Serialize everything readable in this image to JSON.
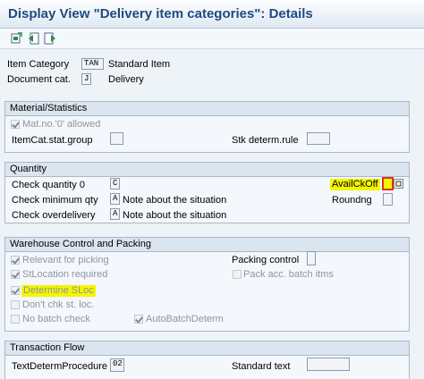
{
  "window": {
    "title": "Display View \"Delivery item categories\": Details"
  },
  "header": {
    "item_category_label": "Item Category",
    "item_category_value": "TAN",
    "item_category_desc": "Standard Item",
    "document_cat_label": "Document cat.",
    "document_cat_value": "J",
    "document_cat_desc": "Delivery"
  },
  "material_statistics": {
    "title": "Material/Statistics",
    "mat_no_label": "Mat.no.'0' allowed",
    "mat_no_checked": true,
    "itemcat_stat_label": "ItemCat.stat.group",
    "itemcat_stat_value": "",
    "stk_determ_label": "Stk determ.rule",
    "stk_determ_value": ""
  },
  "quantity": {
    "title": "Quantity",
    "check_qty_label": "Check quantity 0",
    "check_qty_value": "C",
    "check_min_label": "Check minimum qty",
    "check_min_value": "A",
    "check_min_desc": "Note about the situation",
    "check_over_label": "Check overdelivery",
    "check_over_value": "A",
    "check_over_desc": "Note about the situation",
    "availckoff_label": "AvailCkOff",
    "availckoff_value": "",
    "roundng_label": "Roundng",
    "roundng_value": ""
  },
  "warehouse": {
    "title": "Warehouse Control and Packing",
    "relevant_picking_label": "Relevant for picking",
    "relevant_picking_checked": true,
    "stloc_required_label": "StLocation required",
    "stloc_required_checked": true,
    "determine_sloc_label": "Determine SLoc",
    "determine_sloc_checked": true,
    "dont_chk_label": "Don't chk st. loc.",
    "dont_chk_checked": false,
    "no_batch_label": "No batch check",
    "no_batch_checked": false,
    "auto_batch_label": "AutoBatchDeterm",
    "auto_batch_checked": true,
    "packing_control_label": "Packing control",
    "packing_control_value": "",
    "pack_acc_label": "Pack acc. batch itms",
    "pack_acc_checked": false
  },
  "transaction_flow": {
    "title": "Transaction Flow",
    "text_determ_label": "TextDetermProcedure",
    "text_determ_value": "02",
    "standard_text_label": "Standard text",
    "standard_text_value": ""
  },
  "colors": {
    "highlight": "#f5f500",
    "title_text": "#1e4a80",
    "focus_border": "#e0302a"
  },
  "icons": [
    "other-entry-icon",
    "previous-entry-icon",
    "next-entry-icon"
  ]
}
